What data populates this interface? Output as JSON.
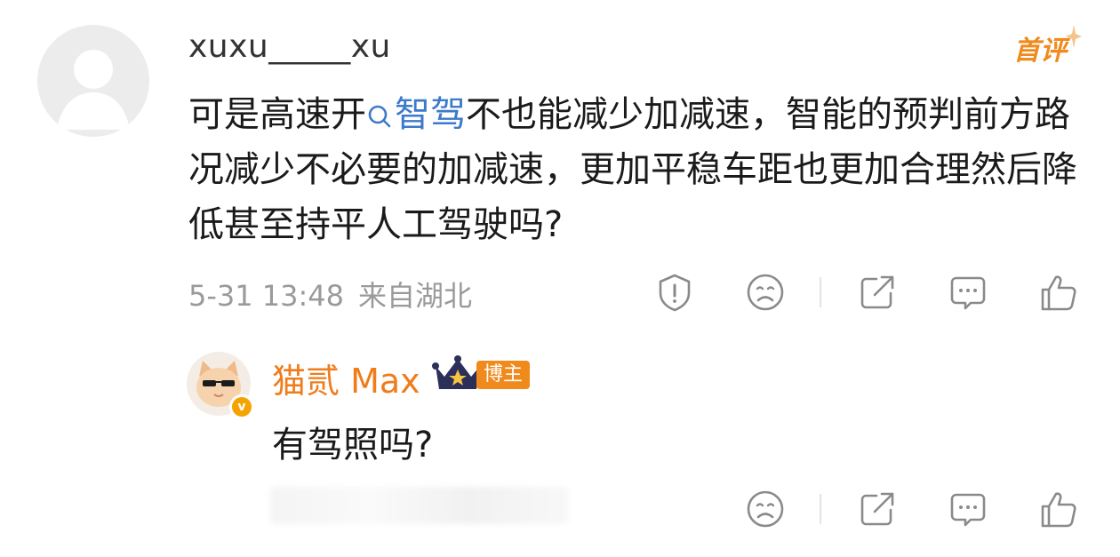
{
  "comment": {
    "username": "xuxu_____xu",
    "first_badge": "首评",
    "text_before_link": "可是高速开",
    "topic_link": "智驾",
    "text_after_link": "不也能减少加减速，智能的预判前方路况减少不必要的加减速，更加平稳车距也更加合理然后降低甚至持平人工驾驶吗?",
    "date": "5-31 13:48",
    "location": "来自湖北",
    "actions": [
      "report-icon",
      "dislike-icon",
      "share-icon",
      "comment-icon",
      "like-icon"
    ]
  },
  "reply": {
    "username": "猫贰 Max",
    "host_badge": "博主",
    "text": "有驾照吗?",
    "actions": [
      "dislike-icon",
      "share-icon",
      "comment-icon",
      "like-icon"
    ]
  },
  "colors": {
    "accent_orange": "#f08a1c",
    "link_blue": "#3d7ac9",
    "meta_gray": "#9a9a9a",
    "icon_gray": "#8a8a8a"
  }
}
